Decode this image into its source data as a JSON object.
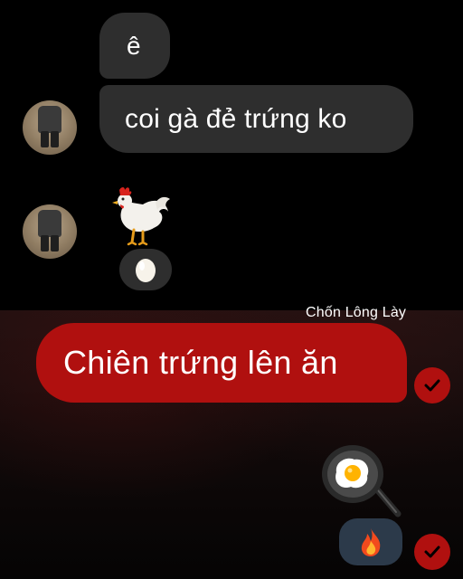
{
  "chat_top": {
    "message_1": "ê",
    "message_2": "coi gà đẻ trứng ko",
    "sticker_1": "rooster-emoji",
    "reaction_1": "egg-emoji"
  },
  "watermark": "Chốn Lông Lày",
  "chat_bottom": {
    "message_1": "Chiên trứng lên ăn",
    "sticker_1": "fried-egg-pan-emoji",
    "reaction_1": "fire-emoji",
    "status_icon": "check-circle-icon"
  },
  "colors": {
    "sent_bubble": "#b0100f",
    "received_bubble": "#2e2e2e",
    "background": "#000000"
  }
}
